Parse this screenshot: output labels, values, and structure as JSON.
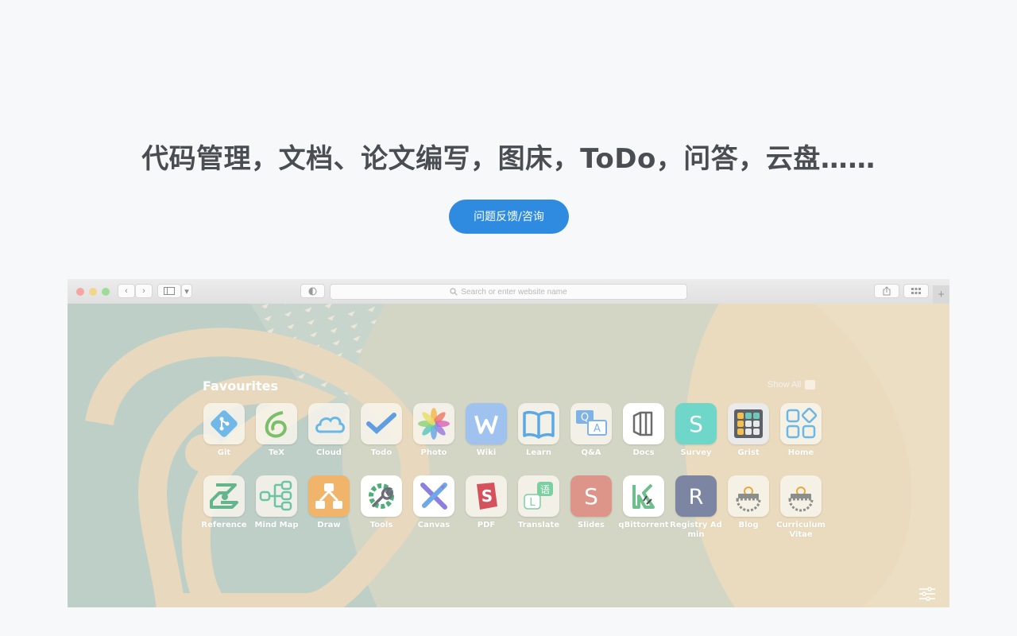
{
  "hero": {
    "title": "代码管理，文档、论文编写，图床，ToDo，问答，云盘……",
    "button_label": "问题反馈/咨询"
  },
  "browser": {
    "address_placeholder": "Search or enter website name",
    "plus_tab": "+"
  },
  "favourites": {
    "title": "Favourites",
    "show_all": "Show All",
    "row1": [
      {
        "label": "Git",
        "icon": "git-icon"
      },
      {
        "label": "TeX",
        "icon": "overleaf-icon"
      },
      {
        "label": "Cloud",
        "icon": "cloud-icon"
      },
      {
        "label": "Todo",
        "icon": "todo-check-icon"
      },
      {
        "label": "Photo",
        "icon": "photo-pinwheel-icon"
      },
      {
        "label": "Wiki",
        "icon": "wiki-w-icon"
      },
      {
        "label": "Learn",
        "icon": "open-book-icon"
      },
      {
        "label": "Q&A",
        "icon": "qa-bubbles-icon"
      },
      {
        "label": "Docs",
        "icon": "docs-icon"
      },
      {
        "label": "Survey",
        "icon": "survey-s-icon"
      },
      {
        "label": "Grist",
        "icon": "grist-icon"
      },
      {
        "label": "Home",
        "icon": "home-grid-icon"
      }
    ],
    "row2": [
      {
        "label": "Reference",
        "icon": "reference-icon"
      },
      {
        "label": "Mind Map",
        "icon": "mind-map-icon"
      },
      {
        "label": "Draw",
        "icon": "draw-diagram-icon"
      },
      {
        "label": "Tools",
        "icon": "tools-gear-icon"
      },
      {
        "label": "Canvas",
        "icon": "canvas-icon"
      },
      {
        "label": "PDF",
        "icon": "pdf-icon"
      },
      {
        "label": "Translate",
        "icon": "translate-icon"
      },
      {
        "label": "Slides",
        "icon": "slides-s-icon"
      },
      {
        "label": "qBittorrent",
        "icon": "qbittorrent-icon"
      },
      {
        "label": "Registry Admin",
        "icon": "registry-r-icon"
      },
      {
        "label": "Blog",
        "icon": "blog-gear-icon"
      },
      {
        "label": "Curriculum Vitae",
        "icon": "cv-gear-icon"
      }
    ]
  },
  "colors": {
    "accent": "#2e8bdf",
    "title_text": "#4a4d52",
    "page_bg": "#f7f8fa"
  }
}
